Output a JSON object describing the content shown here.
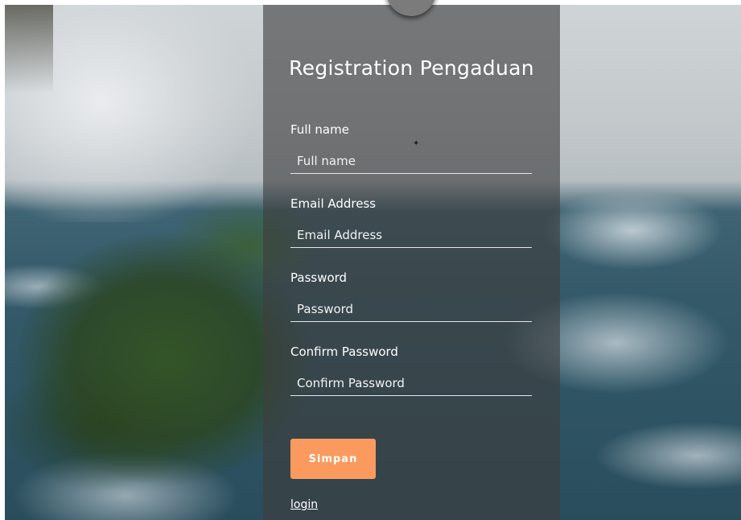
{
  "form": {
    "title": "Registration Pengaduan",
    "fields": [
      {
        "label": "Full name",
        "placeholder": "Full name",
        "value": ""
      },
      {
        "label": "Email Address",
        "placeholder": "Email Address",
        "value": ""
      },
      {
        "label": "Password",
        "placeholder": "Password",
        "value": ""
      },
      {
        "label": "Confirm Password",
        "placeholder": "Confirm Password",
        "value": ""
      }
    ],
    "submit_label": "Simpan",
    "login_link": "login"
  },
  "colors": {
    "accent": "#fb9a5e",
    "panel": "#3e3e3e",
    "text": "#ffffff"
  },
  "icons": {
    "avatar": "user-avatar-icon",
    "bird": "bird-icon"
  }
}
